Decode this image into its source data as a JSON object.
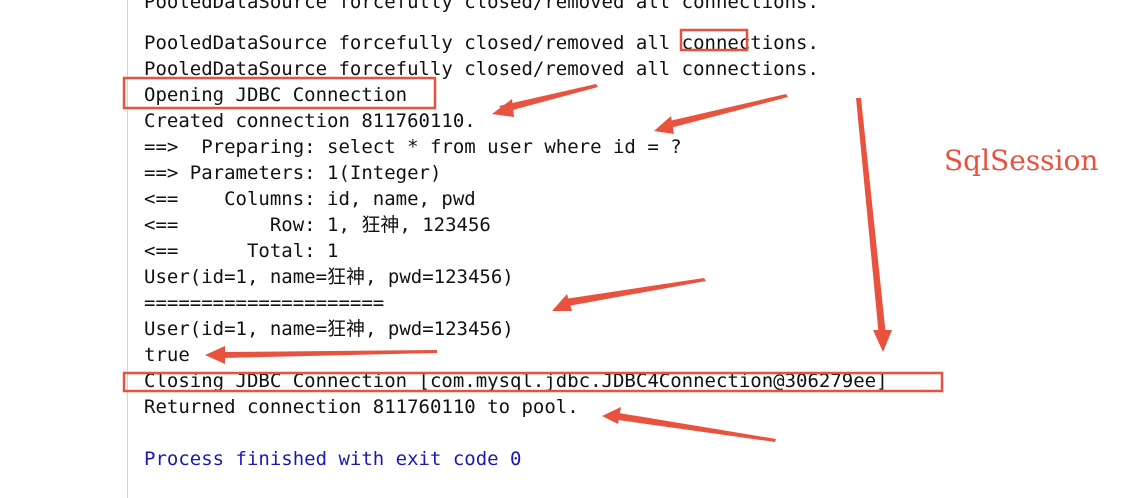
{
  "console": {
    "lines": [
      "PooledDataSource forcefully closed/removed all connections.",
      "PooledDataSource forcefully closed/removed all connections.",
      "PooledDataSource forcefully closed/removed all connections.",
      "Opening JDBC Connection",
      "Created connection 811760110.",
      "==>  Preparing: select * from user where id = ?",
      "==> Parameters: 1(Integer)",
      "<==    Columns: id, name, pwd",
      "<==        Row: 1, 狂神, 123456",
      "<==      Total: 1",
      "User(id=1, name=狂神, pwd=123456)",
      "=====================",
      "User(id=1, name=狂神, pwd=123456)",
      "true",
      "Closing JDBC Connection [com.mysql.jdbc.JDBC4Connection@306279ee]",
      "Returned connection 811760110 to pool.",
      "",
      "Process finished with exit code 0"
    ]
  },
  "annotation": {
    "label": "SqlSession",
    "color": "#e8533f"
  }
}
